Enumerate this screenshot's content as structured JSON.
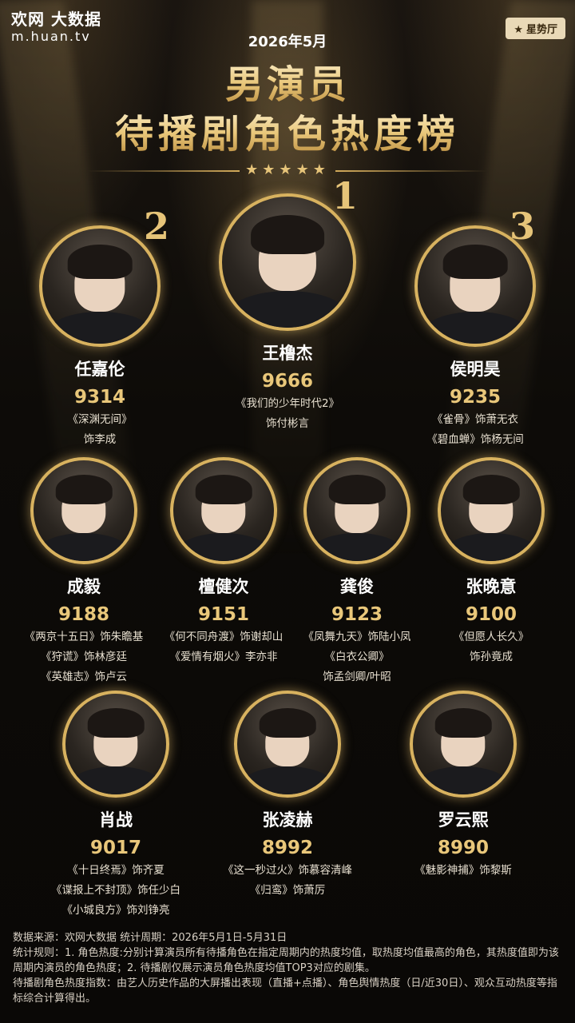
{
  "brand": {
    "line1": "欢网 大数据",
    "line2": "m.huan.tv"
  },
  "badge": {
    "icon": "star-icon",
    "label": "星势厅"
  },
  "header": {
    "date": "2026年5月",
    "title1": "男演员",
    "title2": "待播剧角色热度榜",
    "stars": "★★★★★"
  },
  "ranks": {
    "r1": "1",
    "r2": "2",
    "r3": "3"
  },
  "actors": [
    {
      "name": "任嘉伦",
      "score": "9314",
      "roles": [
        "《深渊无间》",
        "饰李成"
      ]
    },
    {
      "name": "王橹杰",
      "score": "9666",
      "roles": [
        "《我们的少年时代2》",
        "饰付彬言"
      ]
    },
    {
      "name": "侯明昊",
      "score": "9235",
      "roles": [
        "《雀骨》饰萧无衣",
        "《碧血蝉》饰杨无间"
      ]
    },
    {
      "name": "成毅",
      "score": "9188",
      "roles": [
        "《两京十五日》饰朱瞻基",
        "《狩谎》饰林彦廷",
        "《英雄志》饰卢云"
      ]
    },
    {
      "name": "檀健次",
      "score": "9151",
      "roles": [
        "《何不同舟渡》饰谢却山",
        "《爱情有烟火》李亦非"
      ]
    },
    {
      "name": "龚俊",
      "score": "9123",
      "roles": [
        "《凤舞九天》饰陆小凤",
        "《白衣公卿》",
        "饰孟剑卿/叶昭"
      ]
    },
    {
      "name": "张晚意",
      "score": "9100",
      "roles": [
        "《但愿人长久》",
        "饰孙竟成"
      ]
    },
    {
      "name": "肖战",
      "score": "9017",
      "roles": [
        "《十日终焉》饰齐夏",
        "《谍报上不封顶》饰任少白",
        "《小城良方》饰刘铮亮"
      ]
    },
    {
      "name": "张凌赫",
      "score": "8992",
      "roles": [
        "《这一秒过火》饰慕容清峰",
        "《归鸾》饰萧厉"
      ]
    },
    {
      "name": "罗云熙",
      "score": "8990",
      "roles": [
        "《魅影神捕》饰黎斯"
      ]
    }
  ],
  "footer": {
    "source": "数据来源：欢网大数据    统计周期：2026年5月1日-5月31日",
    "rule": "统计规则：1. 角色热度:分别计算演员所有待播角色在指定周期内的热度均值，取热度均值最高的角色，其热度值即为该周期内演员的角色热度；2. 待播剧仅展示演员角色热度均值TOP3对应的剧集。",
    "index": "待播剧角色热度指数：由艺人历史作品的大屏播出表现（直播+点播）、角色舆情热度（日/近30日）、观众互动热度等指标综合计算得出。"
  }
}
